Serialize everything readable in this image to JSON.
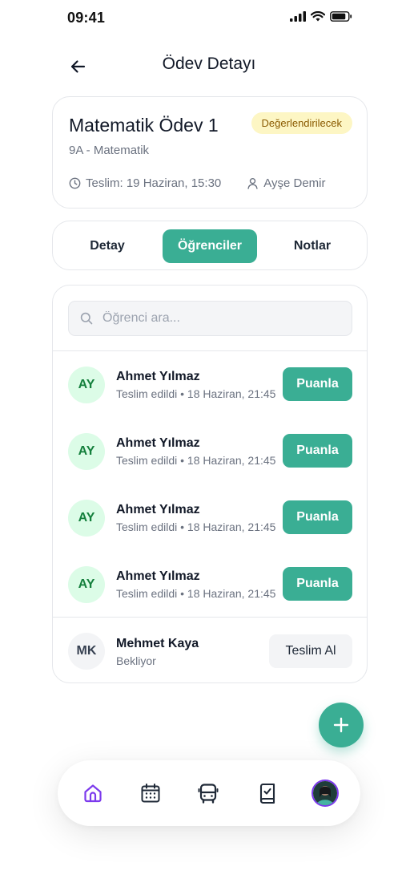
{
  "status_bar": {
    "time": "09:41"
  },
  "header": {
    "title": "Ödev Detayı"
  },
  "assignment": {
    "title": "Matematik Ödev 1",
    "badge": "Değerlendirilecek",
    "subtitle": "9A - Matematik",
    "due": "Teslim: 19 Haziran, 15:30",
    "teacher": "Ayşe Demir"
  },
  "tabs": [
    {
      "label": "Detay",
      "active": false
    },
    {
      "label": "Öğrenciler",
      "active": true
    },
    {
      "label": "Notlar",
      "active": false
    }
  ],
  "search": {
    "placeholder": "Öğrenci ara..."
  },
  "students": [
    {
      "initials": "AY",
      "name": "Ahmet Yılmaz",
      "status": "Teslim edildi • 18 Haziran, 21:45",
      "action": "Puanla"
    },
    {
      "initials": "AY",
      "name": "Ahmet Yılmaz",
      "status": "Teslim edildi • 18 Haziran, 21:45",
      "action": "Puanla"
    },
    {
      "initials": "AY",
      "name": "Ahmet Yılmaz",
      "status": "Teslim edildi • 18 Haziran, 21:45",
      "action": "Puanla"
    },
    {
      "initials": "AY",
      "name": "Ahmet Yılmaz",
      "status": "Teslim edildi • 18 Haziran, 21:45",
      "action": "Puanla"
    },
    {
      "initials": "MK",
      "name": "Mehmet Kaya",
      "status": "Bekliyor",
      "action": "Teslim Al"
    }
  ],
  "bottom_nav": {
    "items": [
      "home-icon",
      "calendar-icon",
      "bus-icon",
      "book-check-icon",
      "profile-avatar"
    ],
    "active": "home-icon"
  },
  "colors": {
    "accent": "#3aae94",
    "active_nav": "#7c3aed",
    "badge_bg": "#fdf6c4",
    "badge_text": "#8a5a00",
    "avatar_green_bg": "#dcfce7",
    "avatar_green_text": "#15803d"
  }
}
